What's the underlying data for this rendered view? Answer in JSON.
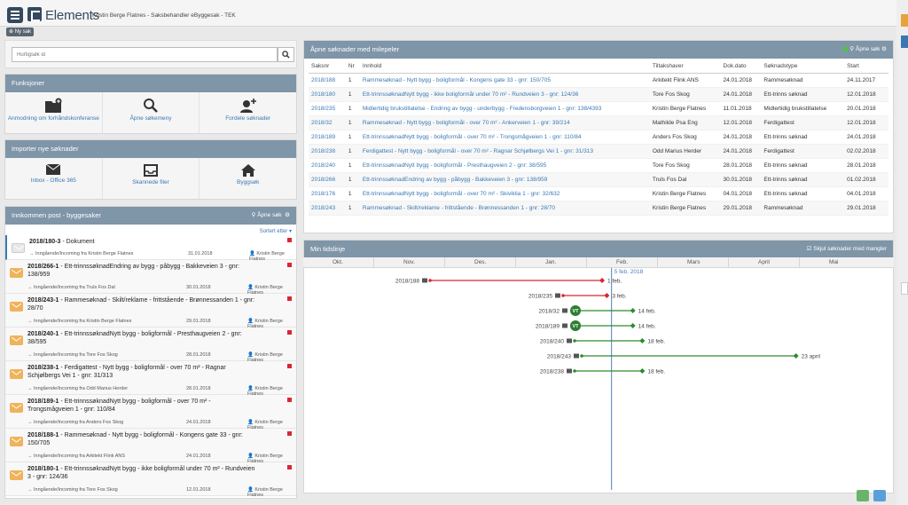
{
  "app": {
    "title": "Elements",
    "subtitle": "Kristin Berge Flatnes - Saksbehandler eByggesak - TEK",
    "new_case": "Ny sak"
  },
  "search": {
    "placeholder": "Hurtigsøk id"
  },
  "functions": {
    "title": "Funksjoner",
    "tiles": [
      {
        "label": "Anmodning om forhåndskonferanse",
        "icon": "folder-plus-icon"
      },
      {
        "label": "Åpne søkemeny",
        "icon": "search-icon"
      },
      {
        "label": "Fordele søknader",
        "icon": "user-plus-icon"
      }
    ]
  },
  "import": {
    "title": "Importer nye søknader",
    "tiles": [
      {
        "label": "Inbox - Office 365",
        "icon": "envelope-icon"
      },
      {
        "label": "Skannede filer",
        "icon": "inbox-tray-icon"
      },
      {
        "label": "Byggsøk",
        "icon": "house-icon"
      }
    ]
  },
  "inbox": {
    "title": "Innkommen post - byggesaker",
    "search_label": "Åpne søk",
    "sort_label": "Sortert etter",
    "items": [
      {
        "id": "2018/180-3",
        "title": "Dokument",
        "from": "Inngående/Incoming fra Kristin Berge Flatnes",
        "date": "31.01.2018",
        "person": "Kristin Berge Flatnes"
      },
      {
        "id": "2018/266-1",
        "title": "Ett-trinnssøknadEndring av bygg - påbygg - Bakkeveien 3 - gnr: 138/959",
        "from": "Inngående/Incoming fra Truls Fos Dal",
        "date": "30.01.2018",
        "person": "Kristin Berge Flatnes"
      },
      {
        "id": "2018/243-1",
        "title": "Rammesøknad - Skilt/reklame - frittstående - Brønnessanden 1 - gnr: 28/70",
        "from": "Inngående/Incoming fra Kristin Berge Flatnes",
        "date": "29.01.2018",
        "person": "Kristin Berge Flatnes"
      },
      {
        "id": "2018/240-1",
        "title": "Ett-trinnssøknadNytt bygg - boligformål - Presthaugveien 2 - gnr: 38/595",
        "from": "Inngående/Incoming fra Tore Fos Skog",
        "date": "28.01.2018",
        "person": "Kristin Berge Flatnes"
      },
      {
        "id": "2018/238-1",
        "title": "Ferdigattest - Nytt bygg - boligformål - over 70 m² - Ragnar Schjølbergs Vei 1 - gnr: 31/313",
        "from": "Inngående/Incoming fra Odd Marius Herder",
        "date": "28.01.2018",
        "person": "Kristin Berge Flatnes"
      },
      {
        "id": "2018/189-1",
        "title": "Ett-trinnssøknadNytt bygg - boligformål - over 70 m² - Trongsmågveien 1 - gnr: 110/84",
        "from": "Inngående/Incoming fra Anders Fos Skog",
        "date": "24.01.2018",
        "person": "Kristin Berge Flatnes"
      },
      {
        "id": "2018/188-1",
        "title": "Rammesøknad - Nytt bygg - boligformål - Kongens gate 33 - gnr: 150/705",
        "from": "Inngående/Incoming fra Arkitekt Flink ANS",
        "date": "24.01.2018",
        "person": "Kristin Berge Flatnes"
      },
      {
        "id": "2018/180-1",
        "title": "Ett-trinnssøknadNytt bygg - ikke boligformål under 70 m² - Rundveien 3 - gnr: 124/36",
        "from": "Inngående/Incoming fra Tore Fos Skog",
        "date": "12.01.2018",
        "person": "Kristin Berge Flatnes"
      }
    ]
  },
  "applications": {
    "title": "Åpne søknader med milepeler",
    "search_label": "Åpne søk",
    "columns": [
      "Saksnr",
      "Nr",
      "Innhold",
      "Tiltakshaver",
      "Dok.dato",
      "Søknadstype",
      "Start"
    ],
    "rows": [
      [
        "2018/188",
        "1",
        "Rammesøknad - Nytt bygg - boligformål - Kongens gate 33 - gnr: 150/705",
        "Arkitekt Flink ANS",
        "24.01.2018",
        "Rammesøknad",
        "24.11.2017"
      ],
      [
        "2018/180",
        "1",
        "Ett-trinnssøknadNytt bygg - ikke boligformål under 70 m² - Rundveien 3 - gnr: 124/36",
        "Tore Fos Skog",
        "24.01.2018",
        "Ett-trinns søknad",
        "12.01.2018"
      ],
      [
        "2018/235",
        "1",
        "Midlertidig brukstillatelse - Endring av bygg - underbygg - Fredensborgveien 1 - gnr: 138/4393",
        "Kristin Berge Flatnes",
        "11.01.2018",
        "Midlertidig brukstillatelse",
        "20.01.2018"
      ],
      [
        "2018/32",
        "1",
        "Rammesøknad - Nytt bygg - boligformål - over 70 m² - Ankerveien 1 - gnr: 39/214",
        "Mathilde Psa Eng",
        "12.01.2018",
        "Ferdigattest",
        "12.01.2018"
      ],
      [
        "2018/189",
        "1",
        "Ett-trinnssøknadNytt bygg - boligformål - over 70 m² - Trongsmågveien 1 - gnr: 110/84",
        "Anders Fos Skog",
        "24.01.2018",
        "Ett-trinns søknad",
        "24.01.2018"
      ],
      [
        "2018/238",
        "1",
        "Ferdigattest - Nytt bygg - boligformål - over 70 m² - Ragnar Schjølbergs Vei 1 - gnr: 31/313",
        "Odd Marius Herder",
        "24.01.2018",
        "Ferdigattest",
        "02.02.2018"
      ],
      [
        "2018/240",
        "1",
        "Ett-trinnssøknadNytt bygg - boligformål - Presthaugveien 2 - gnr: 38/595",
        "Tore Fos Skog",
        "28.01.2018",
        "Ett-trinns søknad",
        "28.01.2018"
      ],
      [
        "2018/266",
        "1",
        "Ett-trinnssøknadEndring av bygg - påbygg - Bakkeveien 3 - gnr: 138/959",
        "Truls Fos Dal",
        "30.01.2018",
        "Ett-trinns søknad",
        "01.02.2018"
      ],
      [
        "2018/176",
        "1",
        "Ett-trinnssøknadNytt bygg - boligformål - over 70 m² - Skiviklia 1 - gnr: 32/632",
        "Kristin Berge Flatnes",
        "04.01.2018",
        "Ett-trinns søknad",
        "04.01.2018"
      ],
      [
        "2018/243",
        "1",
        "Rammesøknad - Skilt/reklame - frittstående - Brønnessanden 1 - gnr: 28/70",
        "Kristin Berge Flatnes",
        "29.01.2018",
        "Rammesøknad",
        "29.01.2018"
      ]
    ]
  },
  "timeline": {
    "title": "Min tidslinje",
    "checkbox_label": "Skjul søknader med mangler",
    "months": [
      "Okt.",
      "Nov.",
      "Des.",
      "Jan.",
      "Feb.",
      "Mars",
      "April",
      "Mai"
    ],
    "today_label": "5 feb. 2018",
    "rows": [
      {
        "case": "2018/188",
        "end_label": "1 feb.",
        "status": "red",
        "vt": false
      },
      {
        "case": "2018/235",
        "end_label": "3 feb.",
        "status": "red",
        "vt": false
      },
      {
        "case": "2018/32",
        "end_label": "14 feb.",
        "status": "green",
        "vt": true,
        "vt_label": "VT"
      },
      {
        "case": "2018/189",
        "end_label": "14 feb.",
        "status": "green",
        "vt": true,
        "vt_label": "VT"
      },
      {
        "case": "2018/240",
        "end_label": "18 feb.",
        "status": "green",
        "vt": false
      },
      {
        "case": "2018/243",
        "end_label": "23 april",
        "status": "green",
        "vt": false
      },
      {
        "case": "2018/238",
        "end_label": "18 feb.",
        "status": "green",
        "vt": false
      }
    ]
  },
  "colors": {
    "header": "#7f95a8",
    "link": "#3a78b4",
    "overdue": "#d9282e",
    "on_time": "#2e8b2e",
    "today_line": "#4a7fc0"
  }
}
